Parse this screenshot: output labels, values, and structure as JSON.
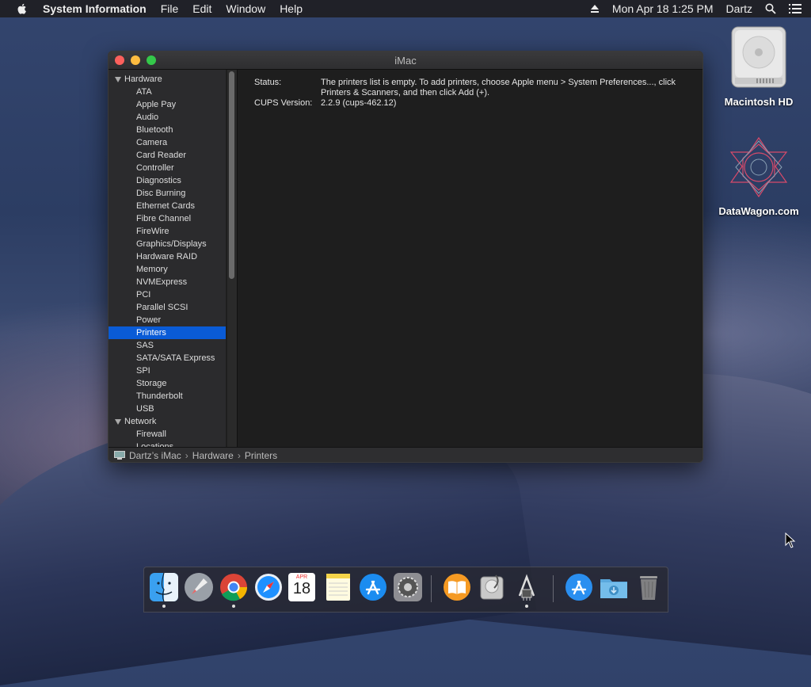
{
  "menubar": {
    "app_name": "System Information",
    "menus": [
      "File",
      "Edit",
      "Window",
      "Help"
    ],
    "datetime": "Mon Apr 18  1:25 PM",
    "user": "Dartz"
  },
  "window": {
    "title": "iMac",
    "sidebar": {
      "groups": [
        {
          "label": "Hardware",
          "items": [
            "ATA",
            "Apple Pay",
            "Audio",
            "Bluetooth",
            "Camera",
            "Card Reader",
            "Controller",
            "Diagnostics",
            "Disc Burning",
            "Ethernet Cards",
            "Fibre Channel",
            "FireWire",
            "Graphics/Displays",
            "Hardware RAID",
            "Memory",
            "NVMExpress",
            "PCI",
            "Parallel SCSI",
            "Power",
            "Printers",
            "SAS",
            "SATA/SATA Express",
            "SPI",
            "Storage",
            "Thunderbolt",
            "USB"
          ]
        },
        {
          "label": "Network",
          "items": [
            "Firewall",
            "Locations"
          ]
        }
      ],
      "selected": "Printers"
    },
    "content": {
      "status_label": "Status:",
      "status_value": "The printers list is empty. To add printers, choose Apple menu > System Preferences..., click Printers & Scanners, and then click Add (+).",
      "cups_label": "CUPS Version:",
      "cups_value": "2.2.9 (cups-462.12)"
    },
    "pathbar": {
      "parts": [
        "Dartz’s iMac",
        "Hardware",
        "Printers"
      ]
    }
  },
  "desktop": {
    "icons": [
      "Macintosh HD",
      "DataWagon.com"
    ]
  },
  "dock": {
    "apps": [
      "finder-icon",
      "launchpad-icon",
      "chrome-icon",
      "safari-icon",
      "calendar-icon",
      "notes-icon",
      "app-store-icon",
      "system-preferences-icon",
      "ibooks-icon",
      "disk-utility-icon",
      "system-information-icon",
      "app-store-downloads-icon",
      "downloads-folder-icon",
      "trash-icon"
    ],
    "calendar_month": "APR",
    "calendar_day": "18"
  }
}
